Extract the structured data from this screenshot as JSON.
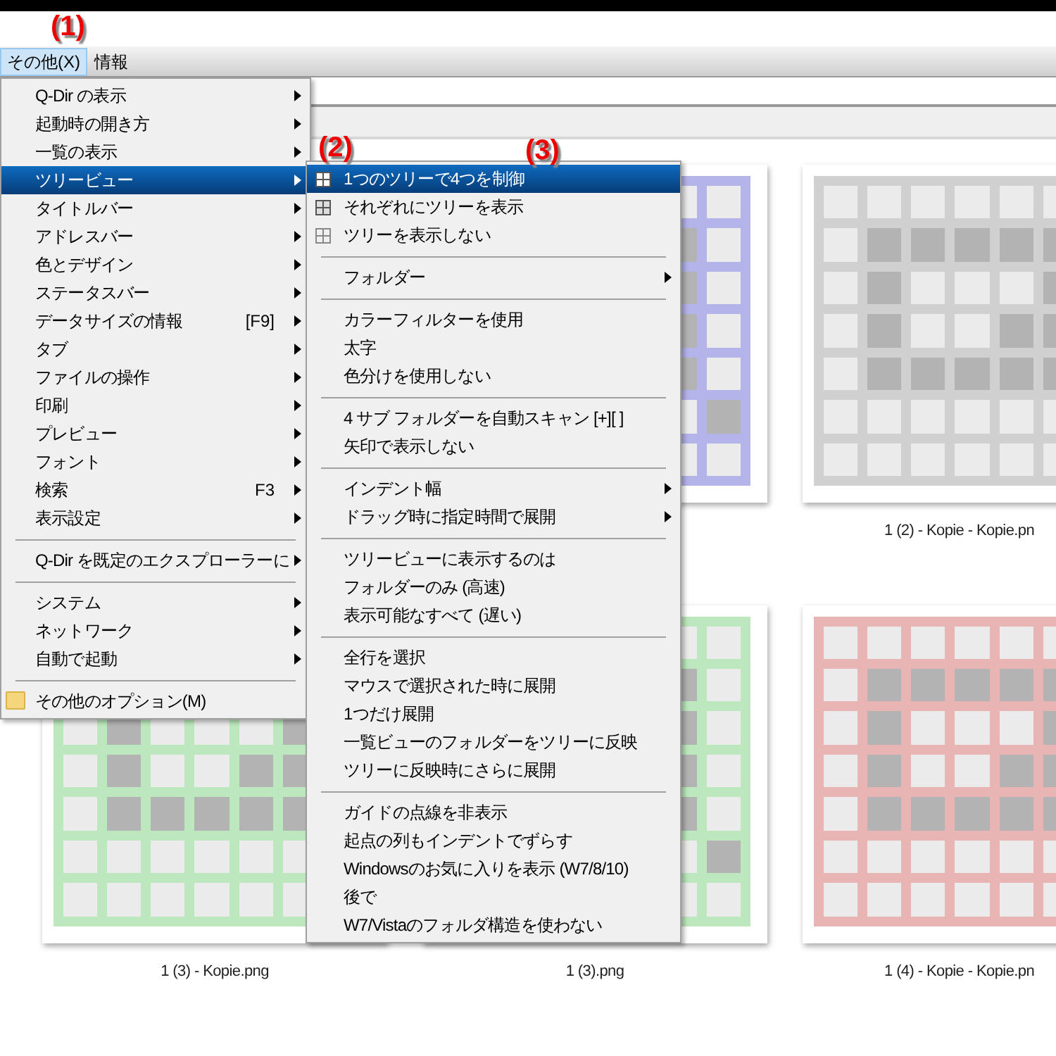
{
  "menubar": [
    {
      "label": "その他(X)",
      "selected": true
    },
    {
      "label": "情報",
      "selected": false
    }
  ],
  "annotations": [
    "(1)",
    "(2)",
    "(3)"
  ],
  "menu": [
    {
      "kind": "item",
      "label": "Q-Dir の表示",
      "submenu": true,
      "selected": false
    },
    {
      "kind": "item",
      "label": "起動時の開き方",
      "submenu": true,
      "selected": false
    },
    {
      "kind": "item",
      "label": "一覧の表示",
      "submenu": true,
      "selected": false
    },
    {
      "kind": "item",
      "label": "ツリービュー",
      "submenu": true,
      "selected": true
    },
    {
      "kind": "item",
      "label": "タイトルバー",
      "submenu": true,
      "selected": false
    },
    {
      "kind": "item",
      "label": "アドレスバー",
      "submenu": true,
      "selected": false
    },
    {
      "kind": "item",
      "label": "色とデザイン",
      "submenu": true,
      "selected": false
    },
    {
      "kind": "item",
      "label": "ステータスバー",
      "submenu": true,
      "selected": false
    },
    {
      "kind": "item",
      "label": "データサイズの情報",
      "shortcut": "[F9]",
      "submenu": true,
      "selected": false
    },
    {
      "kind": "item",
      "label": "タブ",
      "submenu": true,
      "selected": false
    },
    {
      "kind": "item",
      "label": "ファイルの操作",
      "submenu": true,
      "selected": false
    },
    {
      "kind": "item",
      "label": "印刷",
      "submenu": true,
      "selected": false
    },
    {
      "kind": "item",
      "label": "プレビュー",
      "submenu": true,
      "selected": false
    },
    {
      "kind": "item",
      "label": "フォント",
      "submenu": true,
      "selected": false
    },
    {
      "kind": "item",
      "label": "検索",
      "shortcut": "F3",
      "submenu": true,
      "selected": false
    },
    {
      "kind": "item",
      "label": "表示設定",
      "submenu": true,
      "selected": false
    },
    {
      "kind": "separator"
    },
    {
      "kind": "item",
      "label": "Q-Dir を既定のエクスプローラーに",
      "submenu": true,
      "selected": false
    },
    {
      "kind": "separator"
    },
    {
      "kind": "item",
      "label": "システム",
      "submenu": true,
      "selected": false
    },
    {
      "kind": "item",
      "label": "ネットワーク",
      "submenu": true,
      "selected": false
    },
    {
      "kind": "item",
      "label": "自動で起動",
      "submenu": true,
      "selected": false
    },
    {
      "kind": "separator"
    },
    {
      "kind": "folder",
      "label": "その他のオプション(M)",
      "submenu": false,
      "selected": false
    }
  ],
  "submenu": [
    {
      "kind": "grid",
      "label": "1つのツリーで4つを制御",
      "submenu": false,
      "selected": true
    },
    {
      "kind": "grid",
      "label": "それぞれにツリーを表示",
      "submenu": false,
      "selected": false
    },
    {
      "kind": "grid",
      "label": "ツリーを表示しない",
      "submenu": false,
      "selected": false
    },
    {
      "kind": "separator"
    },
    {
      "kind": "item",
      "label": "フォルダー",
      "submenu": true,
      "selected": false
    },
    {
      "kind": "separator"
    },
    {
      "kind": "item",
      "label": "カラーフィルターを使用",
      "submenu": false,
      "selected": false
    },
    {
      "kind": "item",
      "label": "太字",
      "submenu": false,
      "selected": false
    },
    {
      "kind": "item",
      "label": "色分けを使用しない",
      "submenu": false,
      "selected": false
    },
    {
      "kind": "separator"
    },
    {
      "kind": "item",
      "label": "4 サブ フォルダーを自動スキャン [+][ ]",
      "submenu": false,
      "selected": false
    },
    {
      "kind": "item",
      "label": "矢印で表示しない",
      "submenu": false,
      "selected": false
    },
    {
      "kind": "separator"
    },
    {
      "kind": "item",
      "label": "インデント幅",
      "submenu": true,
      "selected": false
    },
    {
      "kind": "item",
      "label": "ドラッグ時に指定時間で展開",
      "submenu": true,
      "selected": false
    },
    {
      "kind": "separator"
    },
    {
      "kind": "item",
      "label": "ツリービューに表示するのは",
      "submenu": false,
      "selected": false
    },
    {
      "kind": "item",
      "label": "フォルダーのみ (高速)",
      "submenu": false,
      "selected": false
    },
    {
      "kind": "item",
      "label": "表示可能なすべて (遅い)",
      "submenu": false,
      "selected": false
    },
    {
      "kind": "separator"
    },
    {
      "kind": "item",
      "label": "全行を選択",
      "submenu": false,
      "selected": false
    },
    {
      "kind": "item",
      "label": "マウスで選択された時に展開",
      "submenu": false,
      "selected": false
    },
    {
      "kind": "item",
      "label": "1つだけ展開",
      "submenu": false,
      "selected": false
    },
    {
      "kind": "item",
      "label": "一覧ビューのフォルダーをツリーに反映",
      "submenu": false,
      "selected": false
    },
    {
      "kind": "item",
      "label": "ツリーに反映時にさらに展開",
      "submenu": false,
      "selected": false
    },
    {
      "kind": "separator"
    },
    {
      "kind": "item",
      "label": "ガイドの点線を非表示",
      "submenu": false,
      "selected": false
    },
    {
      "kind": "item",
      "label": "起点の列もインデントでずらす",
      "submenu": false,
      "selected": false
    },
    {
      "kind": "item",
      "label": "Windowsのお気に入りを表示 (W7/8/10)",
      "submenu": false,
      "selected": false
    },
    {
      "kind": "item",
      "label": "後で",
      "submenu": false,
      "selected": false
    },
    {
      "kind": "item",
      "label": "W7/Vistaのフォルダ構造を使わない",
      "submenu": false,
      "selected": false
    }
  ],
  "thumbnails": [
    {
      "color": "#b4b4ea"
    },
    {
      "color": "#d0d0d0",
      "label": "1 (2) - Kopie - Kopie.pn"
    },
    {
      "color": "#bde8bd",
      "label": "1 (3) - Kopie.png"
    },
    {
      "color": "#bde8bd",
      "label": "1 (3).png"
    },
    {
      "color": "#e8b4b4",
      "label": "1 (4) - Kopie - Kopie.pn"
    }
  ]
}
